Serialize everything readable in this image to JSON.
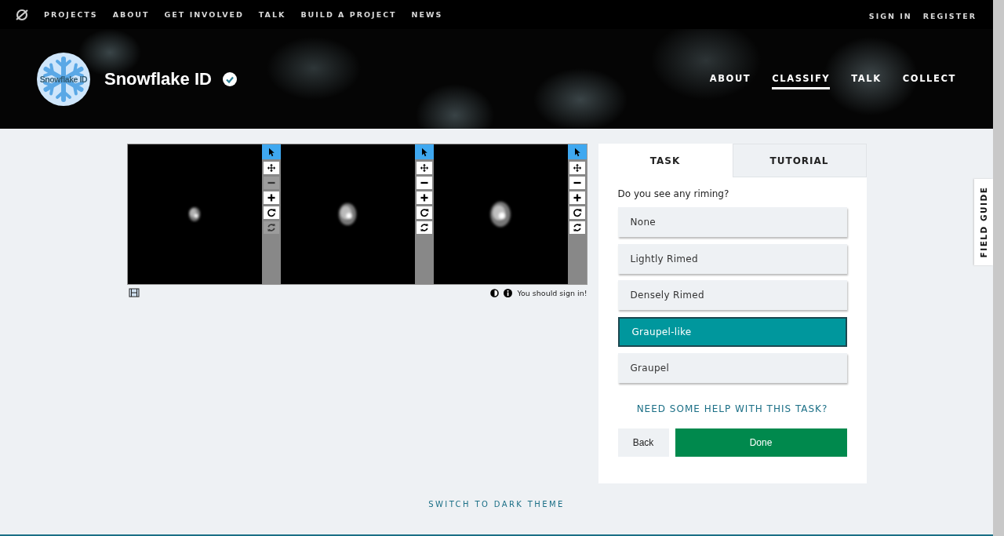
{
  "top_nav": {
    "links": [
      "PROJECTS",
      "ABOUT",
      "GET INVOLVED",
      "TALK",
      "BUILD A PROJECT",
      "NEWS"
    ],
    "account": [
      "SIGN IN",
      "REGISTER"
    ]
  },
  "project": {
    "avatar_text": "Snowflake ID",
    "title": "Snowflake ID",
    "verified": true,
    "tabs": [
      {
        "label": "ABOUT",
        "selected": false
      },
      {
        "label": "CLASSIFY",
        "selected": true
      },
      {
        "label": "TALK",
        "selected": false
      },
      {
        "label": "COLLECT",
        "selected": false
      }
    ]
  },
  "viewer": {
    "frames": [
      {
        "tools": [
          {
            "kind": "pointer",
            "selected": true,
            "disabled": false
          },
          {
            "kind": "move",
            "selected": false,
            "disabled": false
          },
          {
            "kind": "zoom-out",
            "selected": false,
            "disabled": true
          },
          {
            "kind": "zoom-in",
            "selected": false,
            "disabled": false
          },
          {
            "kind": "rotate",
            "selected": false,
            "disabled": false
          },
          {
            "kind": "reset",
            "selected": false,
            "disabled": true
          }
        ]
      },
      {
        "tools": [
          {
            "kind": "pointer",
            "selected": true,
            "disabled": false
          },
          {
            "kind": "move",
            "selected": false,
            "disabled": false
          },
          {
            "kind": "zoom-out",
            "selected": false,
            "disabled": false
          },
          {
            "kind": "zoom-in",
            "selected": false,
            "disabled": false
          },
          {
            "kind": "rotate",
            "selected": false,
            "disabled": false
          },
          {
            "kind": "reset",
            "selected": false,
            "disabled": false
          }
        ]
      },
      {
        "tools": [
          {
            "kind": "pointer",
            "selected": true,
            "disabled": false
          },
          {
            "kind": "move",
            "selected": false,
            "disabled": false
          },
          {
            "kind": "zoom-out",
            "selected": false,
            "disabled": false
          },
          {
            "kind": "zoom-in",
            "selected": false,
            "disabled": false
          },
          {
            "kind": "rotate",
            "selected": false,
            "disabled": false
          },
          {
            "kind": "reset",
            "selected": false,
            "disabled": false
          }
        ]
      }
    ],
    "sign_in_note": "You should sign in!"
  },
  "task_panel": {
    "tabs": [
      {
        "label": "TASK",
        "selected": true
      },
      {
        "label": "TUTORIAL",
        "selected": false
      }
    ],
    "question": "Do you see any riming?",
    "answers": [
      {
        "label": "None",
        "selected": false
      },
      {
        "label": "Lightly Rimed",
        "selected": false
      },
      {
        "label": "Densely Rimed",
        "selected": false
      },
      {
        "label": "Graupel-like",
        "selected": true
      },
      {
        "label": "Graupel",
        "selected": false
      }
    ],
    "help_link": "NEED SOME HELP WITH THIS TASK?",
    "back_button": "Back",
    "done_button": "Done"
  },
  "field_guide": "FIELD GUIDE",
  "footer": {
    "theme_link": "SWITCH TO DARK THEME"
  }
}
